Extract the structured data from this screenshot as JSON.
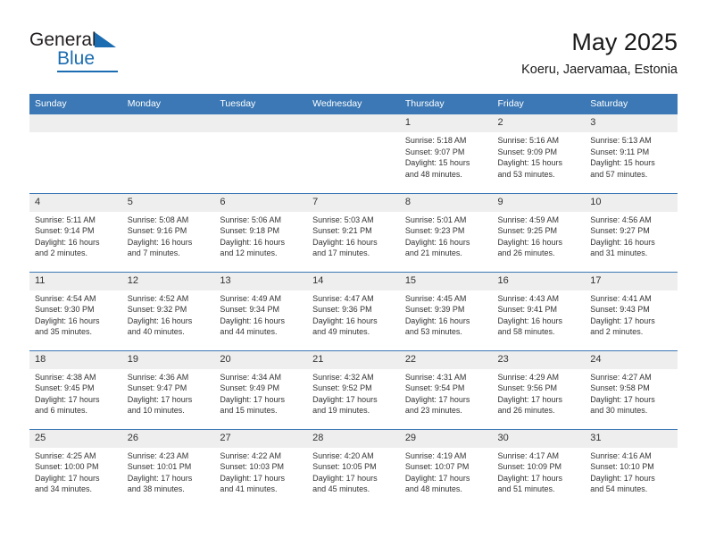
{
  "logo": {
    "word1": "General",
    "word2": "Blue",
    "triangle_color": "#1b6cb0"
  },
  "header": {
    "title": "May 2025",
    "subtitle": "Koeru, Jaervamaa, Estonia",
    "header_bg": "#3b78b5",
    "daynum_bg": "#eeeeee"
  },
  "weekday_headers": [
    "Sunday",
    "Monday",
    "Tuesday",
    "Wednesday",
    "Thursday",
    "Friday",
    "Saturday"
  ],
  "weeks": [
    [
      {
        "day": "",
        "empty": true
      },
      {
        "day": "",
        "empty": true
      },
      {
        "day": "",
        "empty": true
      },
      {
        "day": "",
        "empty": true
      },
      {
        "day": "1",
        "sunrise": "Sunrise: 5:18 AM",
        "sunset": "Sunset: 9:07 PM",
        "daylight_1": "Daylight: 15 hours",
        "daylight_2": "and 48 minutes."
      },
      {
        "day": "2",
        "sunrise": "Sunrise: 5:16 AM",
        "sunset": "Sunset: 9:09 PM",
        "daylight_1": "Daylight: 15 hours",
        "daylight_2": "and 53 minutes."
      },
      {
        "day": "3",
        "sunrise": "Sunrise: 5:13 AM",
        "sunset": "Sunset: 9:11 PM",
        "daylight_1": "Daylight: 15 hours",
        "daylight_2": "and 57 minutes."
      }
    ],
    [
      {
        "day": "4",
        "sunrise": "Sunrise: 5:11 AM",
        "sunset": "Sunset: 9:14 PM",
        "daylight_1": "Daylight: 16 hours",
        "daylight_2": "and 2 minutes."
      },
      {
        "day": "5",
        "sunrise": "Sunrise: 5:08 AM",
        "sunset": "Sunset: 9:16 PM",
        "daylight_1": "Daylight: 16 hours",
        "daylight_2": "and 7 minutes."
      },
      {
        "day": "6",
        "sunrise": "Sunrise: 5:06 AM",
        "sunset": "Sunset: 9:18 PM",
        "daylight_1": "Daylight: 16 hours",
        "daylight_2": "and 12 minutes."
      },
      {
        "day": "7",
        "sunrise": "Sunrise: 5:03 AM",
        "sunset": "Sunset: 9:21 PM",
        "daylight_1": "Daylight: 16 hours",
        "daylight_2": "and 17 minutes."
      },
      {
        "day": "8",
        "sunrise": "Sunrise: 5:01 AM",
        "sunset": "Sunset: 9:23 PM",
        "daylight_1": "Daylight: 16 hours",
        "daylight_2": "and 21 minutes."
      },
      {
        "day": "9",
        "sunrise": "Sunrise: 4:59 AM",
        "sunset": "Sunset: 9:25 PM",
        "daylight_1": "Daylight: 16 hours",
        "daylight_2": "and 26 minutes."
      },
      {
        "day": "10",
        "sunrise": "Sunrise: 4:56 AM",
        "sunset": "Sunset: 9:27 PM",
        "daylight_1": "Daylight: 16 hours",
        "daylight_2": "and 31 minutes."
      }
    ],
    [
      {
        "day": "11",
        "sunrise": "Sunrise: 4:54 AM",
        "sunset": "Sunset: 9:30 PM",
        "daylight_1": "Daylight: 16 hours",
        "daylight_2": "and 35 minutes."
      },
      {
        "day": "12",
        "sunrise": "Sunrise: 4:52 AM",
        "sunset": "Sunset: 9:32 PM",
        "daylight_1": "Daylight: 16 hours",
        "daylight_2": "and 40 minutes."
      },
      {
        "day": "13",
        "sunrise": "Sunrise: 4:49 AM",
        "sunset": "Sunset: 9:34 PM",
        "daylight_1": "Daylight: 16 hours",
        "daylight_2": "and 44 minutes."
      },
      {
        "day": "14",
        "sunrise": "Sunrise: 4:47 AM",
        "sunset": "Sunset: 9:36 PM",
        "daylight_1": "Daylight: 16 hours",
        "daylight_2": "and 49 minutes."
      },
      {
        "day": "15",
        "sunrise": "Sunrise: 4:45 AM",
        "sunset": "Sunset: 9:39 PM",
        "daylight_1": "Daylight: 16 hours",
        "daylight_2": "and 53 minutes."
      },
      {
        "day": "16",
        "sunrise": "Sunrise: 4:43 AM",
        "sunset": "Sunset: 9:41 PM",
        "daylight_1": "Daylight: 16 hours",
        "daylight_2": "and 58 minutes."
      },
      {
        "day": "17",
        "sunrise": "Sunrise: 4:41 AM",
        "sunset": "Sunset: 9:43 PM",
        "daylight_1": "Daylight: 17 hours",
        "daylight_2": "and 2 minutes."
      }
    ],
    [
      {
        "day": "18",
        "sunrise": "Sunrise: 4:38 AM",
        "sunset": "Sunset: 9:45 PM",
        "daylight_1": "Daylight: 17 hours",
        "daylight_2": "and 6 minutes."
      },
      {
        "day": "19",
        "sunrise": "Sunrise: 4:36 AM",
        "sunset": "Sunset: 9:47 PM",
        "daylight_1": "Daylight: 17 hours",
        "daylight_2": "and 10 minutes."
      },
      {
        "day": "20",
        "sunrise": "Sunrise: 4:34 AM",
        "sunset": "Sunset: 9:49 PM",
        "daylight_1": "Daylight: 17 hours",
        "daylight_2": "and 15 minutes."
      },
      {
        "day": "21",
        "sunrise": "Sunrise: 4:32 AM",
        "sunset": "Sunset: 9:52 PM",
        "daylight_1": "Daylight: 17 hours",
        "daylight_2": "and 19 minutes."
      },
      {
        "day": "22",
        "sunrise": "Sunrise: 4:31 AM",
        "sunset": "Sunset: 9:54 PM",
        "daylight_1": "Daylight: 17 hours",
        "daylight_2": "and 23 minutes."
      },
      {
        "day": "23",
        "sunrise": "Sunrise: 4:29 AM",
        "sunset": "Sunset: 9:56 PM",
        "daylight_1": "Daylight: 17 hours",
        "daylight_2": "and 26 minutes."
      },
      {
        "day": "24",
        "sunrise": "Sunrise: 4:27 AM",
        "sunset": "Sunset: 9:58 PM",
        "daylight_1": "Daylight: 17 hours",
        "daylight_2": "and 30 minutes."
      }
    ],
    [
      {
        "day": "25",
        "sunrise": "Sunrise: 4:25 AM",
        "sunset": "Sunset: 10:00 PM",
        "daylight_1": "Daylight: 17 hours",
        "daylight_2": "and 34 minutes."
      },
      {
        "day": "26",
        "sunrise": "Sunrise: 4:23 AM",
        "sunset": "Sunset: 10:01 PM",
        "daylight_1": "Daylight: 17 hours",
        "daylight_2": "and 38 minutes."
      },
      {
        "day": "27",
        "sunrise": "Sunrise: 4:22 AM",
        "sunset": "Sunset: 10:03 PM",
        "daylight_1": "Daylight: 17 hours",
        "daylight_2": "and 41 minutes."
      },
      {
        "day": "28",
        "sunrise": "Sunrise: 4:20 AM",
        "sunset": "Sunset: 10:05 PM",
        "daylight_1": "Daylight: 17 hours",
        "daylight_2": "and 45 minutes."
      },
      {
        "day": "29",
        "sunrise": "Sunrise: 4:19 AM",
        "sunset": "Sunset: 10:07 PM",
        "daylight_1": "Daylight: 17 hours",
        "daylight_2": "and 48 minutes."
      },
      {
        "day": "30",
        "sunrise": "Sunrise: 4:17 AM",
        "sunset": "Sunset: 10:09 PM",
        "daylight_1": "Daylight: 17 hours",
        "daylight_2": "and 51 minutes."
      },
      {
        "day": "31",
        "sunrise": "Sunrise: 4:16 AM",
        "sunset": "Sunset: 10:10 PM",
        "daylight_1": "Daylight: 17 hours",
        "daylight_2": "and 54 minutes."
      }
    ]
  ]
}
